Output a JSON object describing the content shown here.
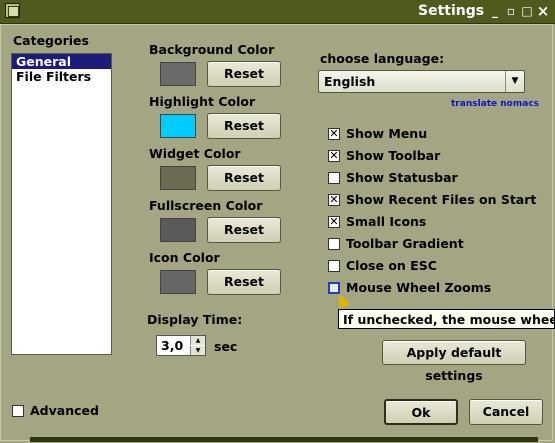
{
  "window": {
    "title": "Settings",
    "minimize": "_",
    "maximize": "□",
    "close": "×",
    "restore": "▫"
  },
  "categories": {
    "label": "Categories",
    "items": [
      {
        "label": "General",
        "selected": true
      },
      {
        "label": "File Filters",
        "selected": false
      }
    ],
    "advanced_label": "Advanced",
    "advanced_checked": false
  },
  "colors": [
    {
      "label": "Background Color",
      "swatch": "#6b6b6b",
      "button": "Reset"
    },
    {
      "label": "Highlight Color",
      "swatch": "#00ccff",
      "button": "Reset"
    },
    {
      "label": "Widget Color",
      "swatch": "#6b6a52",
      "button": "Reset"
    },
    {
      "label": "Fullscreen Color",
      "swatch": "#5a5a5c",
      "button": "Reset"
    },
    {
      "label": "Icon Color",
      "swatch": "#666666",
      "button": "Reset"
    }
  ],
  "display_time": {
    "label": "Display Time:",
    "value": "3,0",
    "unit": "sec"
  },
  "language": {
    "label": "choose language:",
    "selected": "English",
    "link": "translate nomacs"
  },
  "options": [
    {
      "label": "Show Menu",
      "checked": true
    },
    {
      "label": "Show Toolbar",
      "checked": true
    },
    {
      "label": "Show Statusbar",
      "checked": false
    },
    {
      "label": "Show Recent Files on Start",
      "checked": true
    },
    {
      "label": "Small Icons",
      "checked": true
    },
    {
      "label": "Toolbar Gradient",
      "checked": false
    },
    {
      "label": "Close on ESC",
      "checked": false
    },
    {
      "label": "Mouse Wheel Zooms",
      "checked": false
    }
  ],
  "tooltip": "If unchecked, the mouse wheel swit",
  "apply_default": "Apply default settings",
  "ok": "Ok",
  "cancel": "Cancel"
}
